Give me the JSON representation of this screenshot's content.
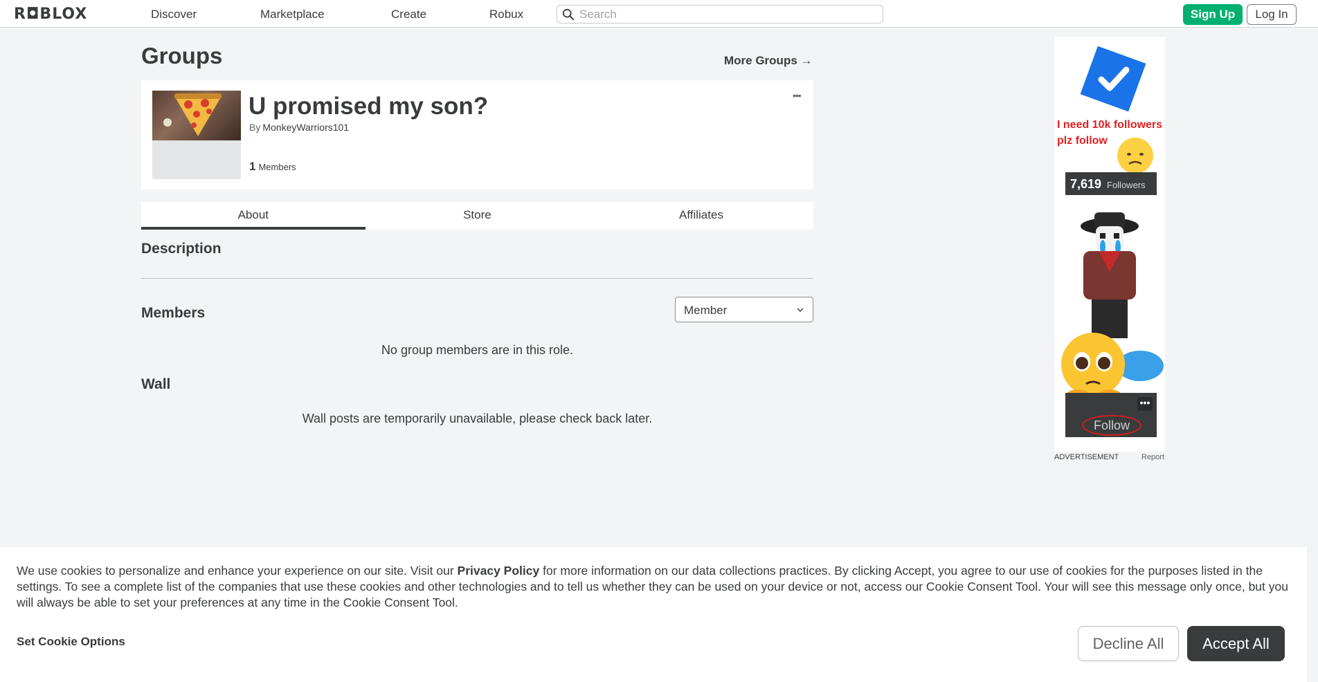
{
  "header": {
    "logo": "R◘BLOX",
    "nav": [
      "Discover",
      "Marketplace",
      "Create",
      "Robux"
    ],
    "search_placeholder": "Search",
    "signup_label": "Sign Up",
    "login_label": "Log In"
  },
  "page": {
    "title": "Groups",
    "more_groups_label": "More Groups →"
  },
  "group": {
    "name": "U promised my son?",
    "by_prefix": "By",
    "owner": "MonkeyWarriors101",
    "member_count": "1",
    "members_label": "Members",
    "menu_glyph": "•••"
  },
  "tabs": [
    "About",
    "Store",
    "Affiliates"
  ],
  "about": {
    "description_heading": "Description",
    "members_heading": "Members",
    "role_selected": "Member",
    "no_members_msg": "No group members are in this role.",
    "wall_heading": "Wall",
    "wall_msg": "Wall posts are temporarily unavailable, please check back later."
  },
  "ad": {
    "text_line1": "I need 10k followers",
    "text_line2": "plz follow",
    "followers_count": "7,619",
    "followers_label": "Followers",
    "follow_label": "Follow",
    "dots": "•••",
    "advertisement_label": "ADVERTISEMENT",
    "report_label": "Report"
  },
  "cookie": {
    "text_before": "We use cookies to personalize and enhance your experience on our site. Visit our ",
    "privacy_link": "Privacy Policy",
    "text_after": " for more information on our data collections practices. By clicking Accept, you agree to our use of cookies for the purposes listed in the settings. To see a complete list of the companies that use these cookies and other technologies and to tell us whether they can be used on your device or not, access our Cookie Consent Tool. Your will see this message only once, but you will always be able to set your preferences at any time in the Cookie Consent Tool.",
    "set_options_label": "Set Cookie Options",
    "decline_label": "Decline All",
    "accept_label": "Accept All"
  },
  "colors": {
    "signup_green": "#00b06f",
    "ad_red_text": "#e02020",
    "checkmark_blue": "#1a73e8",
    "dark_button": "#393b3d"
  }
}
